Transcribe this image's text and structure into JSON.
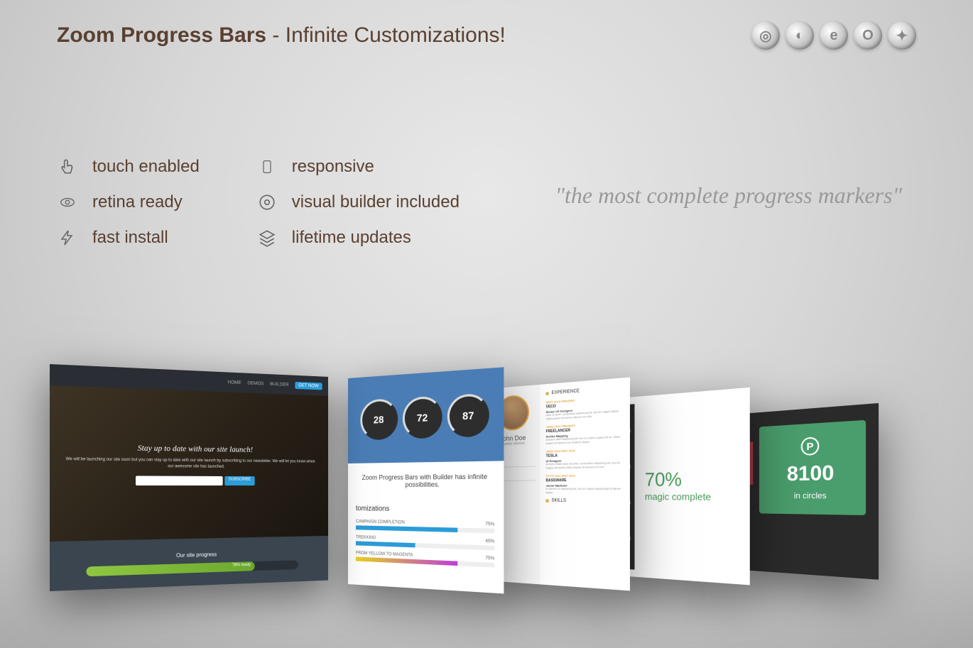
{
  "header": {
    "title_bold": "Zoom Progress Bars",
    "title_rest": " - Infinite Customizations!"
  },
  "features": {
    "col1": [
      {
        "label": "touch enabled",
        "icon": "hand"
      },
      {
        "label": "retina ready",
        "icon": "eye"
      },
      {
        "label": "fast install",
        "icon": "bolt"
      }
    ],
    "col2": [
      {
        "label": "responsive",
        "icon": "phone"
      },
      {
        "label": "visual builder included",
        "icon": "gear"
      },
      {
        "label": "lifetime updates",
        "icon": "layers"
      }
    ]
  },
  "quote": "\"the most complete progress markers\"",
  "card1": {
    "nav": [
      "HOME",
      "DEMOS",
      "BUILDER"
    ],
    "cta": "GET NOW",
    "hero_title": "Stay up to date with our site launch!",
    "hero_sub": "We will be launching our site soon but you can stay up to date with our site launch by subscribing to our newsletter. We will let you know when our awesome site has launched.",
    "subscribe": "SUBSCRIBE",
    "progress_title": "Our site progress",
    "progress_label": "78% ready",
    "progress_pct": 78
  },
  "card2": {
    "circles": [
      "28",
      "72",
      "87"
    ],
    "tagline": "Zoom Progress Bars with Builder has infinite possibilities.",
    "section_title": "tomizations",
    "bars": [
      {
        "label": "CAMPAIGN COMPLETION",
        "pct": "75%"
      },
      {
        "label": "TREKKING",
        "pct": "45%"
      },
      {
        "label": "FROM YELLOW TO MAGENTA",
        "pct": "75%"
      }
    ]
  },
  "card3": {
    "name": "John Doe",
    "role": "creative director",
    "right_title": "EXPERIENCE",
    "skills_title": "SKILLS",
    "exps": [
      {
        "date": "SEPT 2015 PRESENT",
        "company": "VECO",
        "position": "Senior UX Designer",
        "desc": "dolor sit amet, consectetur adipiscing elit, sed do magna aliqua. Ullam araean sit ameno labores non dito."
      },
      {
        "date": "JANU 2011 PRESENT",
        "company": "FREELANCER",
        "position": "ArcGis Mapping",
        "desc": "at larem ullam adipiscing elit, sed do caane magna elit ac. Ullam araean sit labores non ut labore aliqua."
      },
      {
        "date": "JANU 2014 MAY 2015",
        "company": "TESLA",
        "position": "UI Designer",
        "desc": "at lorem elitam dolor sit amet, consectetur adipiscing elit, sed do magna elit anerta Ullam araean sit labores non dito."
      },
      {
        "date": "OCTO 2011 MAY 2013",
        "company": "BASSWARE",
        "position": "Junior Marketer",
        "desc": "en denem co adipiscing elit, sed do magna adipiscinget ut labore aliqua."
      }
    ]
  },
  "card4": {
    "pct": "70%",
    "label": "magic complete"
  },
  "card5": {
    "number": "8100",
    "label": "in circles"
  }
}
